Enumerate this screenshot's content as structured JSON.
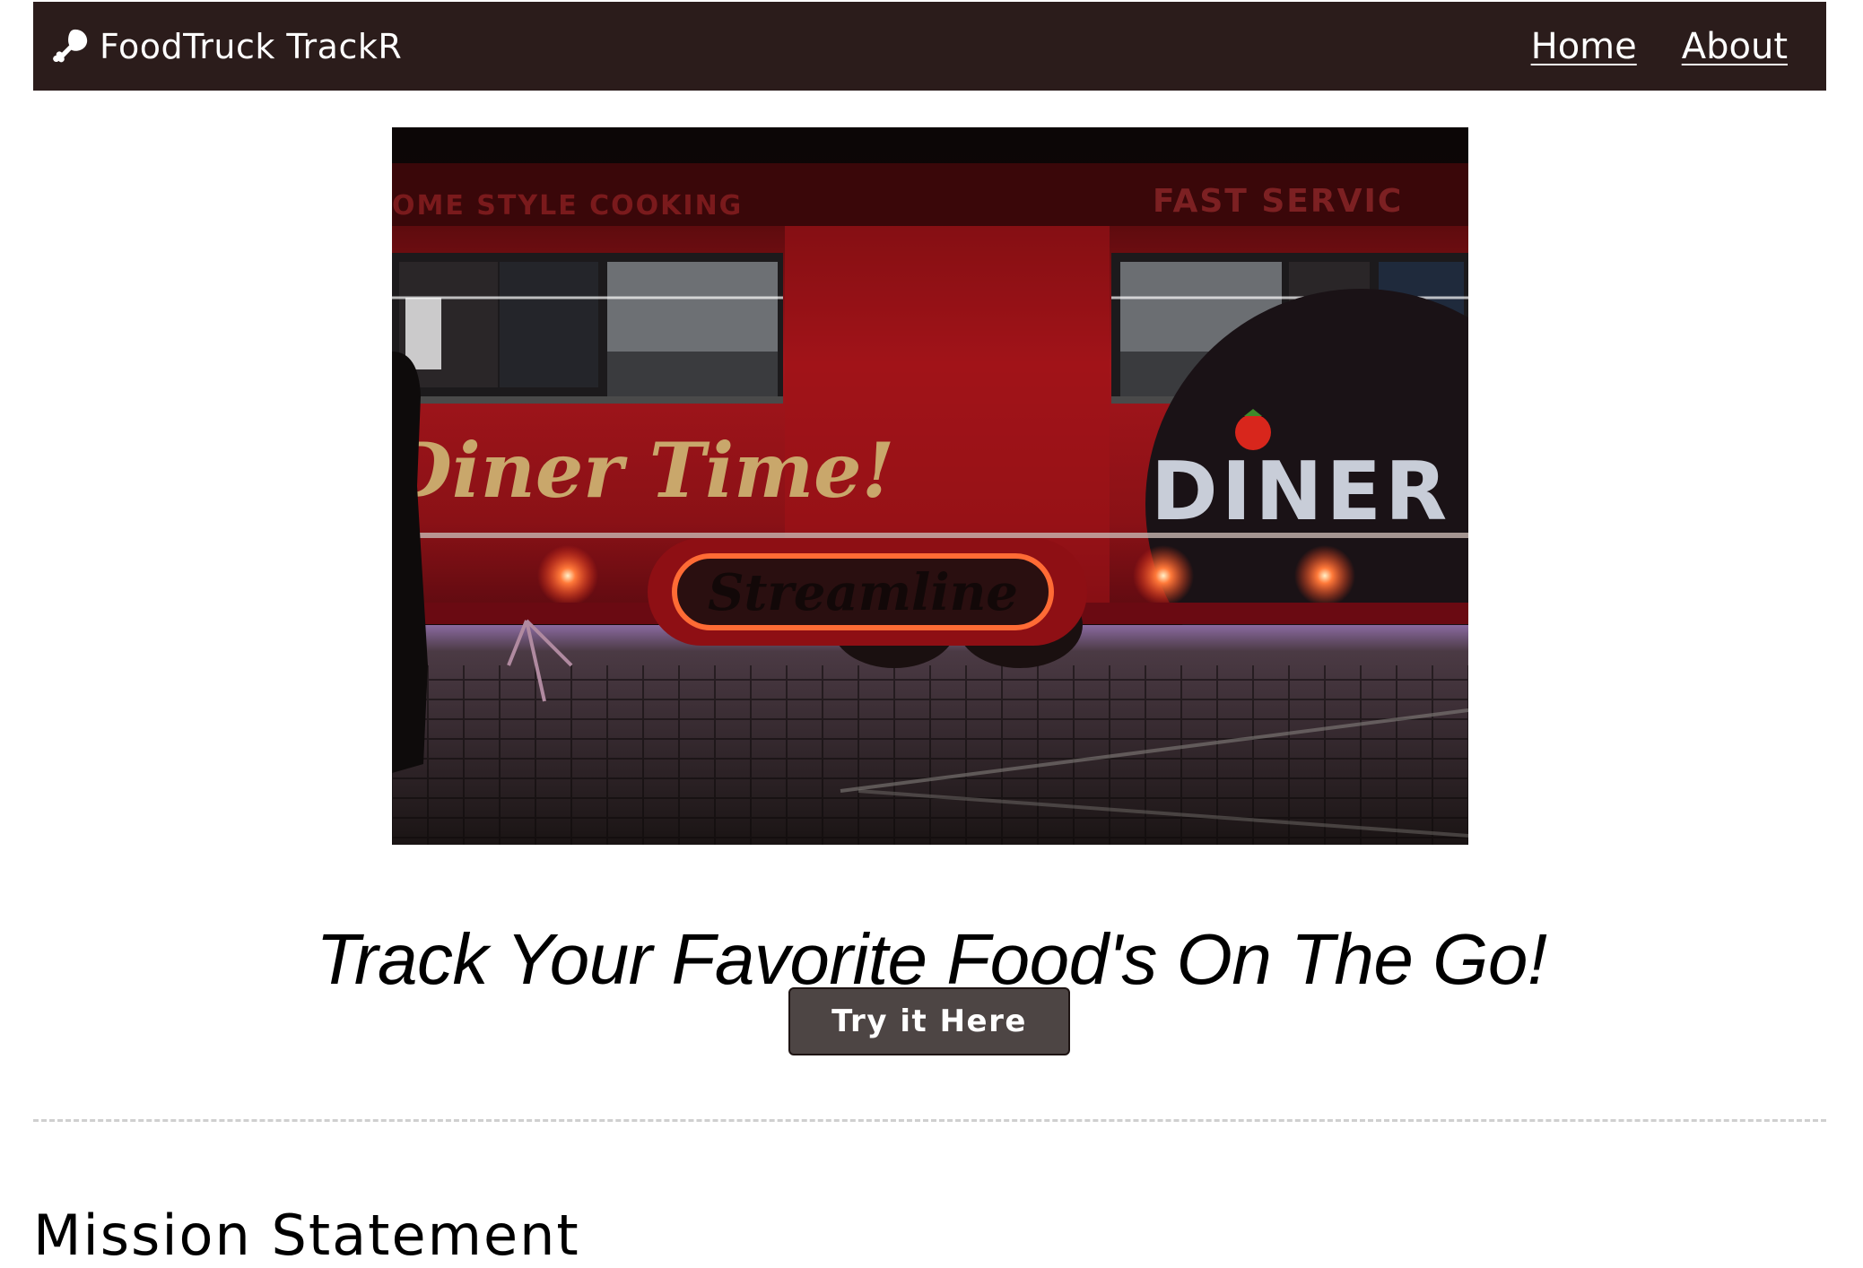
{
  "app": {
    "brand_name": "FoodTruck TrackR",
    "brand_icon": "drumstick-icon"
  },
  "nav": {
    "links": [
      {
        "label": "Home"
      },
      {
        "label": "About"
      }
    ]
  },
  "hero": {
    "image_texts": {
      "sign_left": "OME STYLE COOKING",
      "sign_right": "FAST SERVIC",
      "script_left": "Diner Time!",
      "logo_right": "DINER",
      "plate": "Streamline"
    }
  },
  "main": {
    "tagline": "Track Your Favorite Food's On The Go!",
    "cta_label": "Try it Here",
    "section_title": "Mission Statement"
  },
  "colors": {
    "navbar_bg": "#2b1c1b",
    "button_bg": "#4d4544",
    "truck_red": "#a3151b",
    "divider": "#cfcfcf"
  }
}
